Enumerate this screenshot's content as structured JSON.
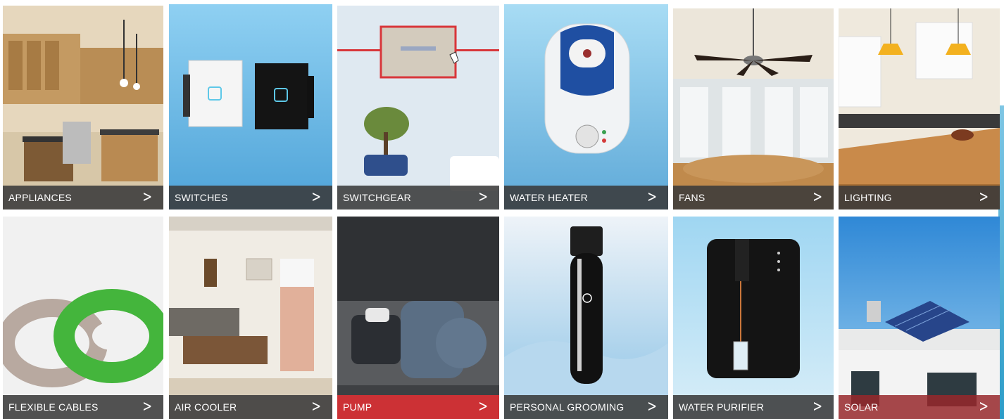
{
  "categories": [
    {
      "label": "APPLIANCES"
    },
    {
      "label": "SWITCHES"
    },
    {
      "label": "SWITCHGEAR"
    },
    {
      "label": "WATER HEATER"
    },
    {
      "label": "FANS"
    },
    {
      "label": "LIGHTING"
    },
    {
      "label": "FLEXIBLE CABLES"
    },
    {
      "label": "AIR COOLER"
    },
    {
      "label": "PUMP"
    },
    {
      "label": "PERSONAL GROOMING"
    },
    {
      "label": "WATER PURIFIER"
    },
    {
      "label": "SOLAR"
    }
  ],
  "icons": {
    "chevron": "chevron-right-icon"
  },
  "colors": {
    "bar": "#3a3a3a",
    "bar_active": "#d83034",
    "label": "#ffffff"
  }
}
